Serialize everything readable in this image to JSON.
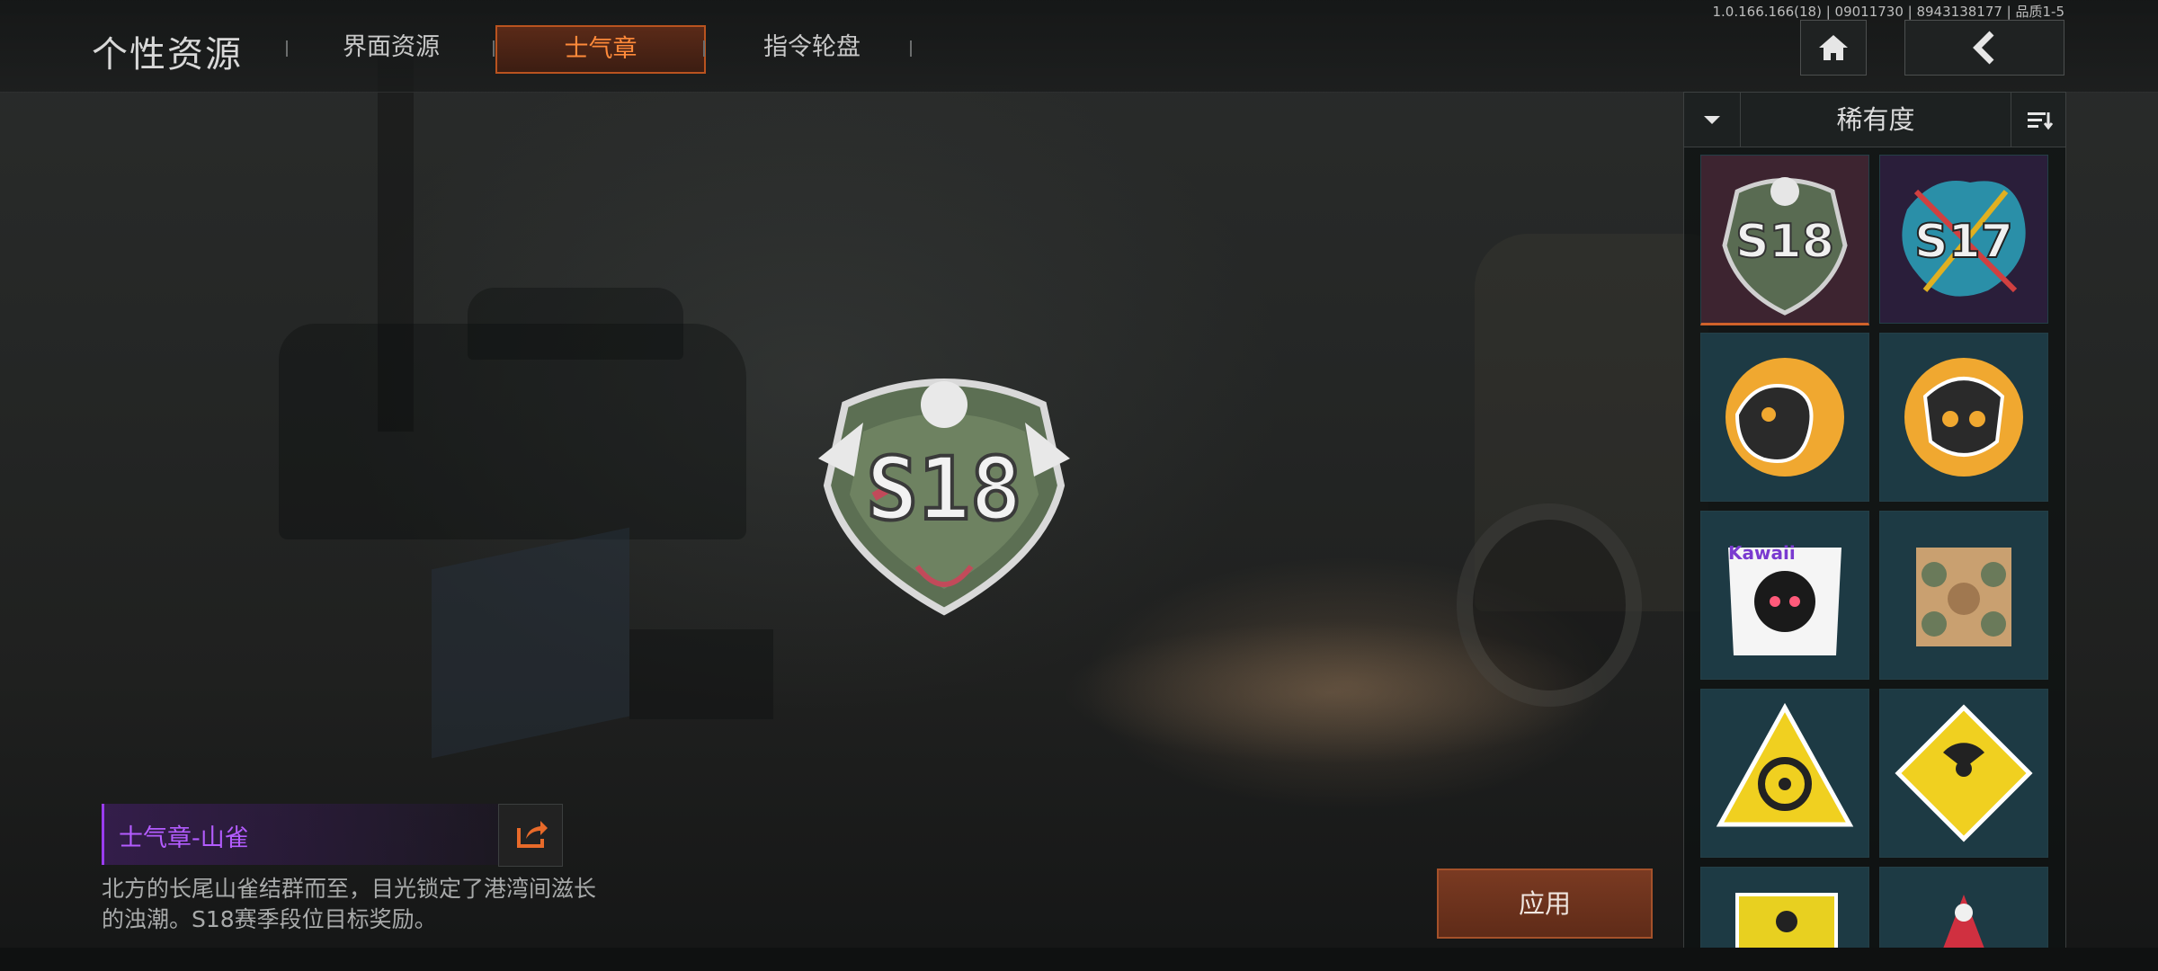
{
  "header": {
    "title": "个性资源",
    "tabs": [
      {
        "label": "界面资源",
        "active": false
      },
      {
        "label": "士气章",
        "active": true
      },
      {
        "label": "指令轮盘",
        "active": false
      }
    ],
    "version": "1.0.166.166(18) | 09011730 | 8943138177 | 品质1-5"
  },
  "badge": {
    "text": "S18"
  },
  "info": {
    "title": "士气章-山雀",
    "description": "北方的长尾山雀结群而至，目光锁定了港湾间滋长的浊潮。S18赛季段位目标奖励。"
  },
  "apply_label": "应用",
  "sort": {
    "label": "稀有度"
  },
  "grid": [
    {
      "text": "S18",
      "selected": true
    },
    {
      "text": "S17"
    },
    {
      "text": ""
    },
    {
      "text": ""
    },
    {
      "text": "Kawaii"
    },
    {
      "text": ""
    },
    {
      "text": ""
    },
    {
      "text": ""
    },
    {
      "text": ""
    },
    {
      "text": ""
    }
  ],
  "colors": {
    "accent": "#ff8a3a",
    "rare_purple": "#b35cff",
    "apply_bg": "#6b3220"
  }
}
